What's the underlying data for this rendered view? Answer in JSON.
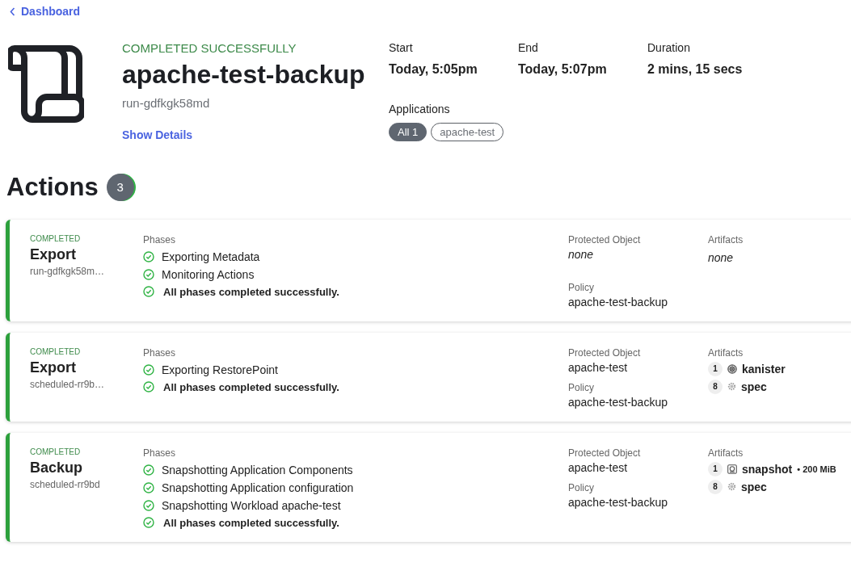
{
  "back_link": {
    "label": "Dashboard"
  },
  "run": {
    "status": "COMPLETED SUCCESSFULLY",
    "name": "apache-test-backup",
    "id": "run-gdfkgk58md",
    "details_link": "Show Details"
  },
  "meta": [
    {
      "label": "Start",
      "value": "Today, 5:05pm"
    },
    {
      "label": "End",
      "value": "Today, 5:07pm"
    },
    {
      "label": "Duration",
      "value": "2 mins, 15 secs"
    }
  ],
  "applications": {
    "label": "Applications",
    "chips": [
      {
        "label": "All 1",
        "selected": true
      },
      {
        "label": "apache-test",
        "selected": false
      }
    ]
  },
  "actions": {
    "title": "Actions",
    "count": "3",
    "cards": [
      {
        "status": "COMPLETED",
        "type": "Export",
        "id": "run-gdfkgk58m…",
        "phases_label": "Phases",
        "phases": [
          {
            "kind": "step",
            "label": "Exporting Metadata"
          },
          {
            "kind": "step",
            "label": "Monitoring Actions"
          },
          {
            "kind": "summary",
            "label": "All phases completed successfully."
          }
        ],
        "protected_label": "Protected Object",
        "protected_object": "none",
        "protected_missing": true,
        "policy_label": "Policy",
        "policy": "apache-test-backup",
        "artifacts_label": "Artifacts",
        "artifacts_empty": "none"
      },
      {
        "status": "COMPLETED",
        "type": "Export",
        "id": "scheduled-rr9b…",
        "phases_label": "Phases",
        "phases": [
          {
            "kind": "step",
            "label": "Exporting RestorePoint"
          },
          {
            "kind": "summary",
            "label": "All phases completed successfully."
          }
        ],
        "protected_label": "Protected Object",
        "protected_object": "apache-test",
        "protected_missing": false,
        "policy_label": "Policy",
        "policy": "apache-test-backup",
        "artifacts_label": "Artifacts",
        "artifacts": [
          {
            "count": "1",
            "kind": "kanister",
            "name": "kanister"
          },
          {
            "count": "8",
            "kind": "spec",
            "name": "spec"
          }
        ]
      },
      {
        "status": "COMPLETED",
        "type": "Backup",
        "id": "scheduled-rr9bd",
        "phases_label": "Phases",
        "phases": [
          {
            "kind": "step",
            "label": "Snapshotting Application Components"
          },
          {
            "kind": "step",
            "label": "Snapshotting Application configuration"
          },
          {
            "kind": "step",
            "label": "Snapshotting Workload apache-test"
          },
          {
            "kind": "summary",
            "label": "All phases completed successfully."
          }
        ],
        "protected_label": "Protected Object",
        "protected_object": "apache-test",
        "protected_missing": false,
        "policy_label": "Policy",
        "policy": "apache-test-backup",
        "artifacts_label": "Artifacts",
        "artifacts": [
          {
            "count": "1",
            "kind": "snapshot",
            "name": "snapshot",
            "size": "• 200 MiB"
          },
          {
            "count": "8",
            "kind": "spec",
            "name": "spec"
          }
        ]
      }
    ]
  }
}
